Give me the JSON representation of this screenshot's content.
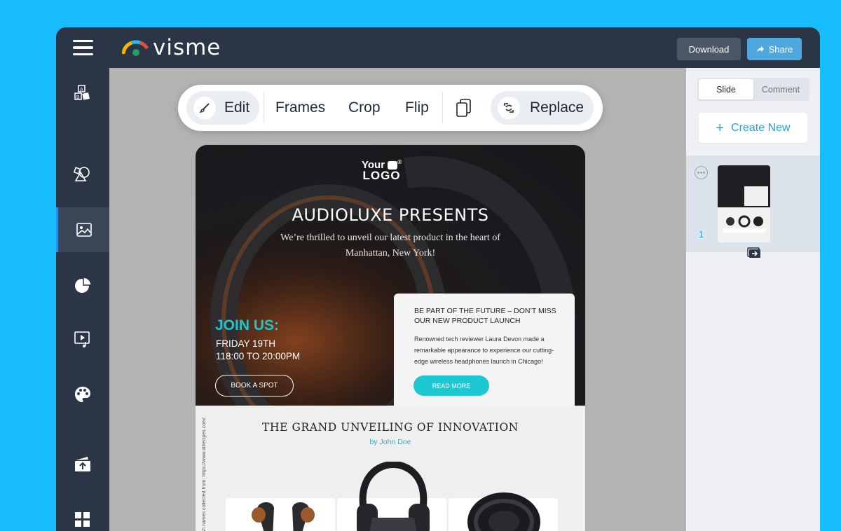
{
  "app": {
    "logo_text": "visme"
  },
  "header": {
    "download_label": "Download",
    "share_label": "Share"
  },
  "sidebar": {
    "items": [
      {
        "icon": "text-blocks-icon"
      },
      {
        "icon": "shapes-icon"
      },
      {
        "icon": "photo-icon",
        "active": true
      },
      {
        "icon": "chart-pie-icon"
      },
      {
        "icon": "media-icon"
      },
      {
        "icon": "palette-icon"
      },
      {
        "icon": "upload-icon"
      },
      {
        "icon": "apps-grid-icon"
      }
    ]
  },
  "toolbar": {
    "edit_label": "Edit",
    "frames_label": "Frames",
    "crop_label": "Crop",
    "flip_label": "Flip",
    "replace_label": "Replace"
  },
  "design": {
    "logo_line1": "Your",
    "logo_line2": "LOGO",
    "logo_reg": "®",
    "title": "AUDIOLUXE PRESENTS",
    "subtitle": "We’re thrilled to unveil our latest product in the heart of Manhattan, New York!",
    "join_label": "JOIN US:",
    "date_line1": "FRIDAY 19TH",
    "date_line2": "118:00 TO 20:00PM",
    "book_button": "BOOK A SPOT",
    "card_title": "BE PART OF THE FUTURE – DON’T MISS OUR NEW PRODUCT LAUNCH",
    "card_body": "Renowned tech reviewer Laura Devon made a remarkable appearance to experience our cutting-edge wireless headphones launch in Chicago!",
    "read_more": "READ MORE",
    "section_title": "THE GRAND UNVEILING OF INNOVATION",
    "byline": "by John Doe",
    "vertical_note": "Dish names collected from: https://www.allrecipes.com/"
  },
  "right_panel": {
    "tab_slide": "Slide",
    "tab_comment": "Comment",
    "create_new": "Create New",
    "slide_number": "1"
  },
  "colors": {
    "background": "#17bdfd",
    "chrome": "#2a3646",
    "accent_blue": "#2a9fd6",
    "teal": "#1ec8d2"
  }
}
